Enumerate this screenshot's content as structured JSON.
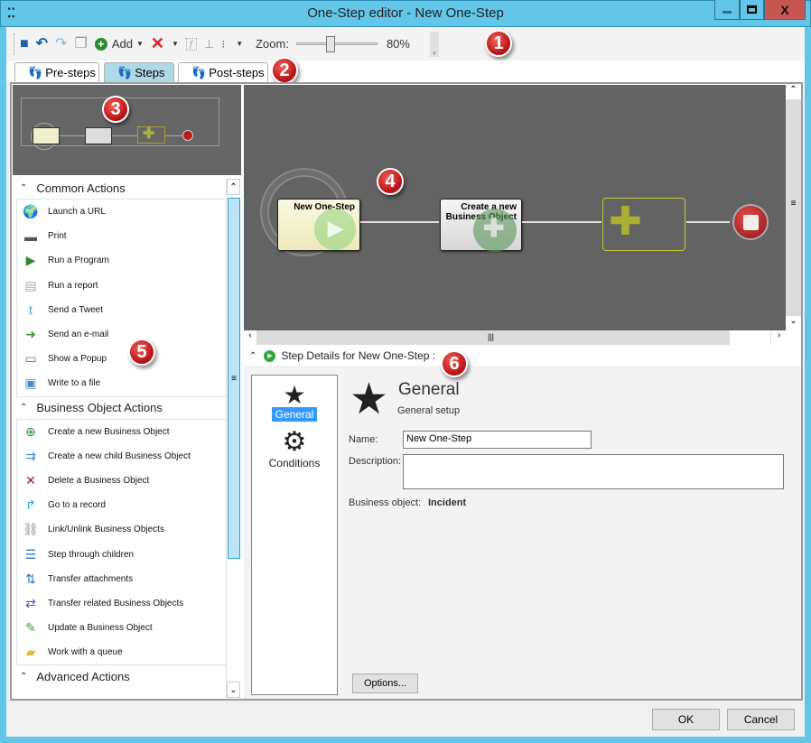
{
  "window": {
    "title": "One-Step editor - New One-Step",
    "app_icon": "footsteps-icon",
    "minimize": "—",
    "maximize": "□",
    "close": "X"
  },
  "toolbar": {
    "add_label": "Add",
    "zoom_label": "Zoom:",
    "zoom_value": "80%",
    "zoom_fraction": 0.4,
    "icons": [
      "save-icon",
      "undo-icon",
      "redo-icon",
      "copy-icon",
      "add-icon",
      "delete-icon",
      "function-icon",
      "hierarchy-icon",
      "layout-icon"
    ]
  },
  "tabs": [
    {
      "label": "Pre-steps",
      "active": false
    },
    {
      "label": "Steps",
      "active": true
    },
    {
      "label": "Post-steps",
      "active": false
    }
  ],
  "callouts": [
    "1",
    "2",
    "3",
    "4",
    "5",
    "6"
  ],
  "actions": {
    "sections": [
      {
        "title": "Common Actions",
        "items": [
          {
            "label": "Launch a URL",
            "icon": "globe-icon"
          },
          {
            "label": "Print",
            "icon": "printer-icon"
          },
          {
            "label": "Run a Program",
            "icon": "program-icon"
          },
          {
            "label": "Run a report",
            "icon": "report-icon"
          },
          {
            "label": "Send a Tweet",
            "icon": "twitter-icon"
          },
          {
            "label": "Send an e-mail",
            "icon": "email-icon"
          },
          {
            "label": "Show a Popup",
            "icon": "popup-icon"
          },
          {
            "label": "Write to a file",
            "icon": "floppy-icon"
          }
        ]
      },
      {
        "title": "Business Object Actions",
        "items": [
          {
            "label": "Create a new Business Object",
            "icon": "plus-circle-icon"
          },
          {
            "label": "Create a new child Business Object",
            "icon": "child-object-icon"
          },
          {
            "label": "Delete a Business Object",
            "icon": "x-icon"
          },
          {
            "label": "Go to a record",
            "icon": "go-arrow-icon"
          },
          {
            "label": "Link/Unlink Business Objects",
            "icon": "link-icon"
          },
          {
            "label": "Step through children",
            "icon": "list-icon"
          },
          {
            "label": "Transfer attachments",
            "icon": "transfer-icon"
          },
          {
            "label": "Transfer related Business Objects",
            "icon": "transfer-related-icon"
          },
          {
            "label": "Update a Business Object",
            "icon": "pencil-icon"
          },
          {
            "label": "Work with a queue",
            "icon": "queue-icon"
          }
        ]
      },
      {
        "title": "Advanced Actions",
        "items": []
      }
    ]
  },
  "diagram": {
    "start_node": "New One-Step",
    "action_node": "Create a new Business Object",
    "action_node_line1": "Create a new",
    "action_node_line2": "Business Object"
  },
  "details": {
    "header": "Step Details for New One-Step :",
    "sidebar": [
      {
        "label": "General",
        "icon": "star-icon",
        "selected": true
      },
      {
        "label": "Conditions",
        "icon": "gear-icon",
        "selected": false
      }
    ],
    "section_title": "General",
    "section_subtitle": "General setup",
    "name_label": "Name:",
    "name_value": "New One-Step",
    "description_label": "Description:",
    "description_value": "",
    "business_object_label": "Business object:",
    "business_object_value": "Incident",
    "options_button": "Options..."
  },
  "footer": {
    "ok": "OK",
    "cancel": "Cancel"
  }
}
